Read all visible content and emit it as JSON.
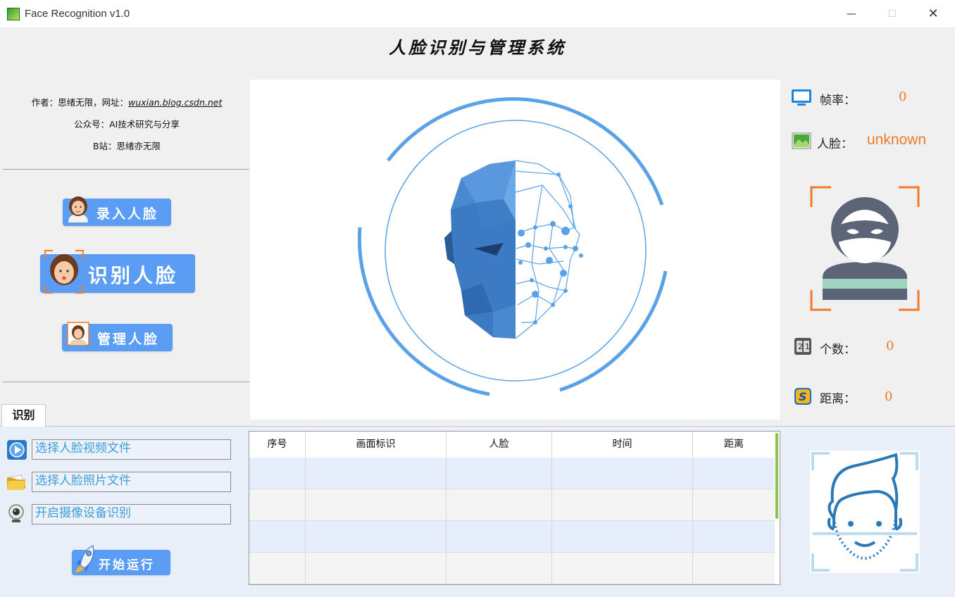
{
  "window": {
    "title": "Face Recognition v1.0",
    "minimize": "—",
    "maximize": "☐",
    "close": "✕"
  },
  "header": {
    "title": "人脸识别与管理系统"
  },
  "info": {
    "author_label": "作者：思绪无限，网址：",
    "author_url": "wuxian.blog.csdn.net",
    "wechat": "公众号：AI技术研究与分享",
    "bilibili": "B站：思绪亦无限"
  },
  "buttons": {
    "enter_face": "录入人脸",
    "recognize_face": "识别人脸",
    "manage_face": "管理人脸",
    "start_run": "开始运行"
  },
  "stats": {
    "fps_label": "帧率：",
    "fps_value": "0",
    "face_label": "人脸：",
    "face_value": "unknown",
    "count_label": "个数：",
    "count_value": "0",
    "distance_label": "距离：",
    "distance_value": "0"
  },
  "tab": {
    "label": "识别"
  },
  "sources": {
    "video": "选择人脸视频文件",
    "photo": "选择人脸照片文件",
    "camera": "开启摄像设备识别"
  },
  "table": {
    "headers": [
      "序号",
      "画面标识",
      "人脸",
      "时间",
      "距离"
    ],
    "rows": 4
  },
  "colors": {
    "accent_blue": "#5b9df5",
    "value_orange": "#f07a2a",
    "link_blue": "#3e9ed8",
    "panel_bg": "#e9eff9"
  },
  "icons": {
    "fps": "monitor-icon",
    "face": "picture-icon",
    "count": "counter-icon",
    "distance": "s-badge-icon",
    "video": "play-icon",
    "photo": "folder-icon",
    "camera": "webcam-icon"
  }
}
